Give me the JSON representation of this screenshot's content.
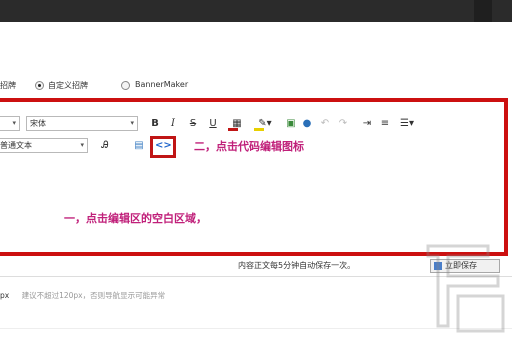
{
  "radio_options": [
    {
      "label": "招牌",
      "checked": false
    },
    {
      "label": "自定义招牌",
      "checked": true
    },
    {
      "label": "BannerMaker",
      "checked": false
    }
  ],
  "toolbar": {
    "font_family_select": "宋体",
    "paragraph_select": "普通文本",
    "bold_label": "B",
    "italic_label": "I",
    "strike_label": "S",
    "underline_label": "U",
    "code_icon_label": "<>"
  },
  "annotations": {
    "step_two": "二，点击代码编辑图标",
    "step_one": "一，点击编辑区的空白区域，"
  },
  "status": {
    "autosave_text": "内容正文每5分钟自动保存一次。",
    "save_now_button": "立即保存"
  },
  "hint": {
    "unit": "px",
    "text": "建议不超过120px，否则导航显示可能异常"
  },
  "colors": {
    "highlight_red": "#cc1010",
    "annotation_magenta": "#c0207a",
    "code_icon_blue": "#2266cc"
  }
}
